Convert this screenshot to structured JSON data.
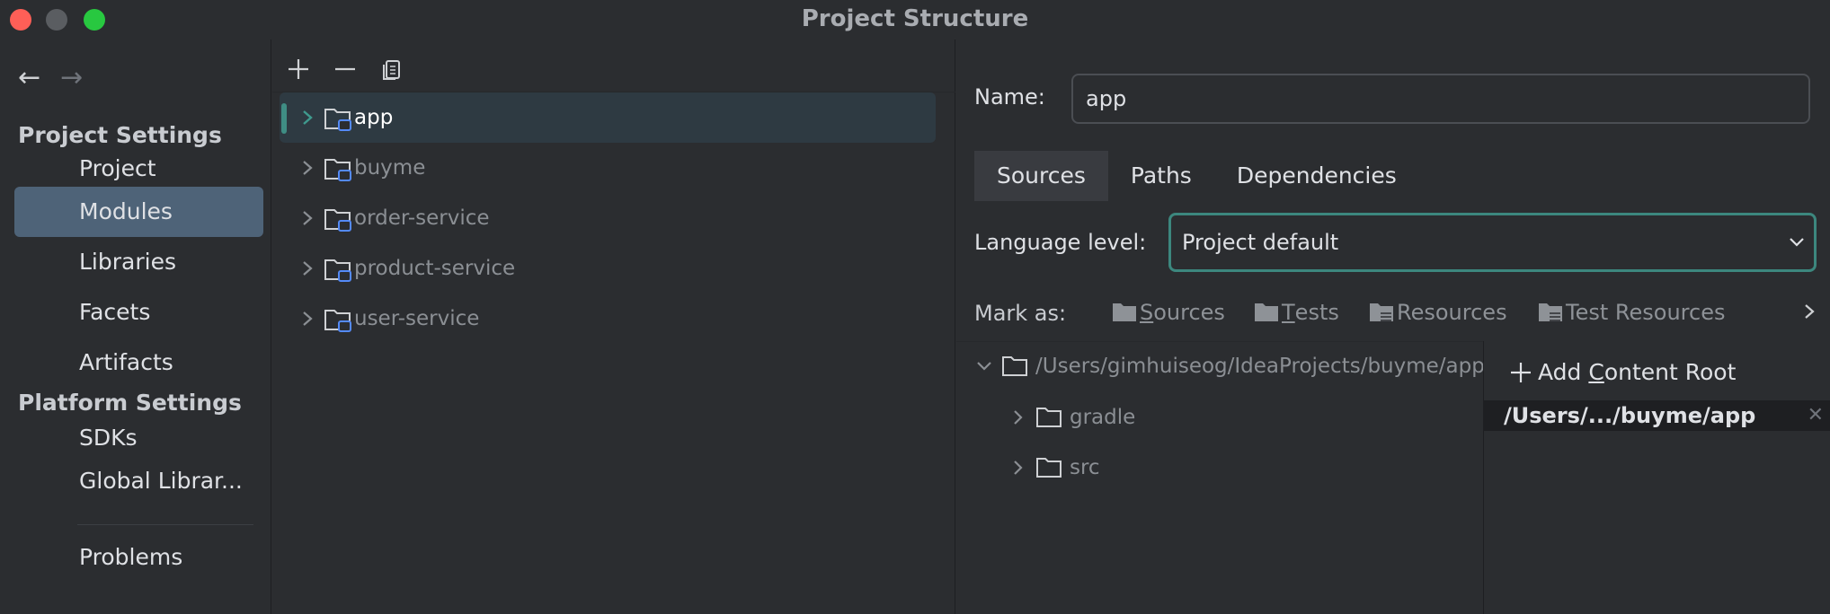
{
  "window": {
    "title": "Project Structure"
  },
  "nav": {
    "back_icon": "arrow-left-icon",
    "forward_icon": "arrow-right-icon",
    "project_settings_header": "Project Settings",
    "platform_settings_header": "Platform Settings",
    "items": {
      "project": "Project",
      "modules": "Modules",
      "libraries": "Libraries",
      "facets": "Facets",
      "artifacts": "Artifacts",
      "sdks": "SDKs",
      "global_libraries": "Global Librar...",
      "problems": "Problems"
    },
    "selected": "modules"
  },
  "modules": {
    "toolbar": {
      "add_icon": "plus-icon",
      "remove_icon": "minus-icon",
      "copy_icon": "copy-icon"
    },
    "list": [
      "app",
      "buyme",
      "order-service",
      "product-service",
      "user-service"
    ],
    "selected": "app"
  },
  "module_detail": {
    "name_label": "Name:",
    "name_value": "app",
    "tabs": [
      "Sources",
      "Paths",
      "Dependencies"
    ],
    "active_tab": "Sources",
    "language_level_label": "Language level:",
    "language_level_value": "Project default",
    "mark_as_label": "Mark as:",
    "mark_as": {
      "sources": {
        "first": "S",
        "rest": "ources"
      },
      "tests": {
        "first": "T",
        "rest": "ests"
      },
      "resources": "Resources",
      "test_resources": "Test Resources"
    },
    "tree": {
      "root_path": "/Users/gimhuiseog/IdeaProjects/buyme/app",
      "children": [
        "gradle",
        "src"
      ]
    },
    "content_roots": {
      "add_label_pre": "Add ",
      "add_label_mnemonic": "C",
      "add_label_post": "ontent Root",
      "root": "/Users/.../buyme/app"
    }
  },
  "colors": {
    "background": "#2b2d30",
    "selection": "#4e6378",
    "focus_accent": "#3c877e",
    "close_button": "#ff5f57",
    "zoom_button": "#28c840"
  }
}
